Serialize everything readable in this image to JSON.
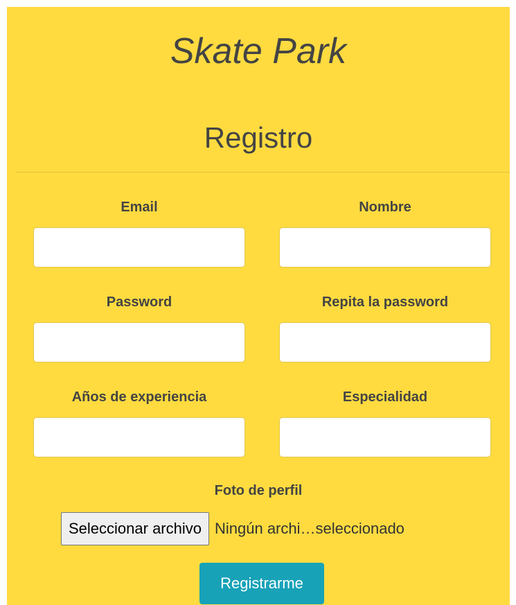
{
  "header": {
    "title": "Skate Park",
    "subtitle": "Registro"
  },
  "form": {
    "email": {
      "label": "Email",
      "value": "",
      "placeholder": ""
    },
    "nombre": {
      "label": "Nombre",
      "value": "",
      "placeholder": ""
    },
    "password": {
      "label": "Password",
      "value": "",
      "placeholder": ""
    },
    "repeat_password": {
      "label": "Repita la password",
      "value": "",
      "placeholder": ""
    },
    "experiencia": {
      "label": "Años de experiencia",
      "value": "",
      "placeholder": ""
    },
    "especialidad": {
      "label": "Especialidad",
      "value": "",
      "placeholder": ""
    },
    "foto": {
      "label": "Foto de perfil",
      "button_label": "Seleccionar archivo",
      "status": "Ningún archi…seleccionado"
    },
    "submit_label": "Registrarme"
  },
  "colors": {
    "background": "#ffdb40",
    "text": "#444444",
    "submit": "#17a2b8"
  }
}
